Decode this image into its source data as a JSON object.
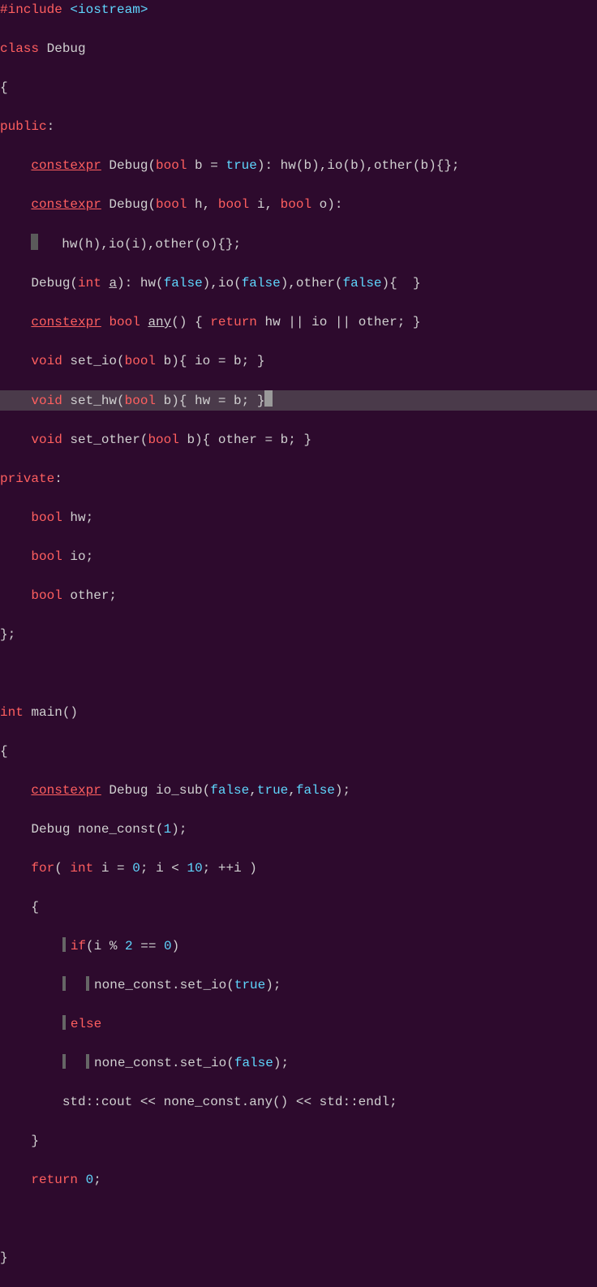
{
  "code": {
    "lines": [
      {
        "hl": false,
        "segs": [
          {
            "t": "#include",
            "c": "pp"
          },
          {
            "t": " ",
            "c": "txt"
          },
          {
            "t": "<iostream>",
            "c": "inc"
          }
        ]
      },
      {
        "hl": false,
        "segs": [
          {
            "t": "class",
            "c": "kw"
          },
          {
            "t": " Debug",
            "c": "txt"
          }
        ]
      },
      {
        "hl": false,
        "segs": [
          {
            "t": "{",
            "c": "txt"
          }
        ]
      },
      {
        "hl": false,
        "segs": [
          {
            "t": "public",
            "c": "access"
          },
          {
            "t": ":",
            "c": "colon"
          }
        ]
      },
      {
        "hl": false,
        "segs": [
          {
            "t": "    ",
            "c": "txt"
          },
          {
            "t": "constexpr",
            "c": "kw under"
          },
          {
            "t": " Debug(",
            "c": "txt"
          },
          {
            "t": "bool",
            "c": "type"
          },
          {
            "t": " b = ",
            "c": "txt"
          },
          {
            "t": "true",
            "c": "boolv"
          },
          {
            "t": "): hw(b),io(b),other(b){};",
            "c": "txt"
          }
        ]
      },
      {
        "hl": false,
        "segs": [
          {
            "t": "    ",
            "c": "txt"
          },
          {
            "t": "constexpr",
            "c": "kw under"
          },
          {
            "t": " Debug(",
            "c": "txt"
          },
          {
            "t": "bool",
            "c": "type"
          },
          {
            "t": " h, ",
            "c": "txt"
          },
          {
            "t": "bool",
            "c": "type"
          },
          {
            "t": " i, ",
            "c": "txt"
          },
          {
            "t": "bool",
            "c": "type"
          },
          {
            "t": " o):",
            "c": "txt"
          }
        ]
      },
      {
        "hl": false,
        "segs": [
          {
            "t": "    ",
            "c": "txt"
          },
          {
            "t": "CURSOR",
            "c": "cursor"
          },
          {
            "t": "   hw(h),io(i),other(o){};",
            "c": "txt"
          }
        ]
      },
      {
        "hl": false,
        "segs": [
          {
            "t": "    Debug(",
            "c": "txt"
          },
          {
            "t": "int",
            "c": "type"
          },
          {
            "t": " ",
            "c": "txt"
          },
          {
            "t": "a",
            "c": "txt under"
          },
          {
            "t": "): hw(",
            "c": "txt"
          },
          {
            "t": "false",
            "c": "boolv"
          },
          {
            "t": "),io(",
            "c": "txt"
          },
          {
            "t": "false",
            "c": "boolv"
          },
          {
            "t": "),other(",
            "c": "txt"
          },
          {
            "t": "false",
            "c": "boolv"
          },
          {
            "t": "){  }",
            "c": "txt"
          }
        ]
      },
      {
        "hl": false,
        "segs": [
          {
            "t": "    ",
            "c": "txt"
          },
          {
            "t": "constexpr",
            "c": "kw under"
          },
          {
            "t": " ",
            "c": "txt"
          },
          {
            "t": "bool",
            "c": "type"
          },
          {
            "t": " ",
            "c": "txt"
          },
          {
            "t": "any",
            "c": "txt under"
          },
          {
            "t": "() { ",
            "c": "txt"
          },
          {
            "t": "return",
            "c": "kw"
          },
          {
            "t": " hw || io || other; }",
            "c": "txt"
          }
        ]
      },
      {
        "hl": false,
        "segs": [
          {
            "t": "    ",
            "c": "txt"
          },
          {
            "t": "void",
            "c": "type"
          },
          {
            "t": " set_io(",
            "c": "txt"
          },
          {
            "t": "bool",
            "c": "type"
          },
          {
            "t": " b){ io = b; }",
            "c": "txt"
          }
        ]
      },
      {
        "hl": true,
        "segs": [
          {
            "t": "    ",
            "c": "txt"
          },
          {
            "t": "void",
            "c": "type"
          },
          {
            "t": " set_hw(",
            "c": "txt"
          },
          {
            "t": "bool",
            "c": "type"
          },
          {
            "t": " b){ hw = b; }",
            "c": "txt"
          },
          {
            "t": "CUR2",
            "c": "cur2"
          }
        ]
      },
      {
        "hl": false,
        "segs": [
          {
            "t": "    ",
            "c": "txt"
          },
          {
            "t": "void",
            "c": "type"
          },
          {
            "t": " set_other(",
            "c": "txt"
          },
          {
            "t": "bool",
            "c": "type"
          },
          {
            "t": " b){ other = b; }",
            "c": "txt"
          }
        ]
      },
      {
        "hl": false,
        "segs": [
          {
            "t": "private",
            "c": "access"
          },
          {
            "t": ":",
            "c": "colon"
          }
        ]
      },
      {
        "hl": false,
        "segs": [
          {
            "t": "    ",
            "c": "txt"
          },
          {
            "t": "bool",
            "c": "type"
          },
          {
            "t": " hw;",
            "c": "txt"
          }
        ]
      },
      {
        "hl": false,
        "segs": [
          {
            "t": "    ",
            "c": "txt"
          },
          {
            "t": "bool",
            "c": "type"
          },
          {
            "t": " io;",
            "c": "txt"
          }
        ]
      },
      {
        "hl": false,
        "segs": [
          {
            "t": "    ",
            "c": "txt"
          },
          {
            "t": "bool",
            "c": "type"
          },
          {
            "t": " other;",
            "c": "txt"
          }
        ]
      },
      {
        "hl": false,
        "segs": [
          {
            "t": "};",
            "c": "txt"
          }
        ]
      },
      {
        "hl": false,
        "segs": [
          {
            "t": " ",
            "c": "txt"
          }
        ]
      },
      {
        "hl": false,
        "segs": [
          {
            "t": "int",
            "c": "type"
          },
          {
            "t": " main()",
            "c": "txt"
          }
        ]
      },
      {
        "hl": false,
        "segs": [
          {
            "t": "{",
            "c": "txt"
          }
        ]
      },
      {
        "hl": false,
        "segs": [
          {
            "t": "    ",
            "c": "txt"
          },
          {
            "t": "constexpr",
            "c": "kw under"
          },
          {
            "t": " Debug io_sub(",
            "c": "txt"
          },
          {
            "t": "false",
            "c": "boolv"
          },
          {
            "t": ",",
            "c": "txt"
          },
          {
            "t": "true",
            "c": "boolv"
          },
          {
            "t": ",",
            "c": "txt"
          },
          {
            "t": "false",
            "c": "boolv"
          },
          {
            "t": ");",
            "c": "txt"
          }
        ]
      },
      {
        "hl": false,
        "segs": [
          {
            "t": "    Debug none_const(",
            "c": "txt"
          },
          {
            "t": "1",
            "c": "num"
          },
          {
            "t": ");",
            "c": "txt"
          }
        ]
      },
      {
        "hl": false,
        "segs": [
          {
            "t": "    ",
            "c": "txt"
          },
          {
            "t": "for",
            "c": "kw"
          },
          {
            "t": "( ",
            "c": "txt"
          },
          {
            "t": "int",
            "c": "type"
          },
          {
            "t": " i = ",
            "c": "txt"
          },
          {
            "t": "0",
            "c": "num"
          },
          {
            "t": "; i < ",
            "c": "txt"
          },
          {
            "t": "10",
            "c": "num"
          },
          {
            "t": "; ++i )",
            "c": "txt"
          }
        ]
      },
      {
        "hl": false,
        "segs": [
          {
            "t": "    {",
            "c": "txt"
          }
        ]
      },
      {
        "hl": false,
        "segs": [
          {
            "t": "        ",
            "c": "txt"
          },
          {
            "t": "GUIDE",
            "c": "indent-guide"
          },
          {
            "t": "if",
            "c": "kw"
          },
          {
            "t": "(i % ",
            "c": "txt"
          },
          {
            "t": "2",
            "c": "num"
          },
          {
            "t": " == ",
            "c": "txt"
          },
          {
            "t": "0",
            "c": "num"
          },
          {
            "t": ")",
            "c": "txt"
          }
        ]
      },
      {
        "hl": false,
        "segs": [
          {
            "t": "        ",
            "c": "txt"
          },
          {
            "t": "GUIDE",
            "c": "indent-guide"
          },
          {
            "t": "  ",
            "c": "txt"
          },
          {
            "t": "GUIDE",
            "c": "indent-guide"
          },
          {
            "t": "none_const.set_io(",
            "c": "txt"
          },
          {
            "t": "true",
            "c": "boolv"
          },
          {
            "t": ");",
            "c": "txt"
          }
        ]
      },
      {
        "hl": false,
        "segs": [
          {
            "t": "        ",
            "c": "txt"
          },
          {
            "t": "GUIDE",
            "c": "indent-guide"
          },
          {
            "t": "else",
            "c": "kw"
          }
        ]
      },
      {
        "hl": false,
        "segs": [
          {
            "t": "        ",
            "c": "txt"
          },
          {
            "t": "GUIDE",
            "c": "indent-guide"
          },
          {
            "t": "  ",
            "c": "txt"
          },
          {
            "t": "GUIDE",
            "c": "indent-guide"
          },
          {
            "t": "none_const.set_io(",
            "c": "txt"
          },
          {
            "t": "false",
            "c": "boolv"
          },
          {
            "t": ");",
            "c": "txt"
          }
        ]
      },
      {
        "hl": false,
        "segs": [
          {
            "t": "        std::cout << none_const.any() << std::endl;",
            "c": "txt"
          }
        ]
      },
      {
        "hl": false,
        "segs": [
          {
            "t": "    }",
            "c": "txt"
          }
        ]
      },
      {
        "hl": false,
        "segs": [
          {
            "t": "    ",
            "c": "txt"
          },
          {
            "t": "return",
            "c": "kw"
          },
          {
            "t": " ",
            "c": "txt"
          },
          {
            "t": "0",
            "c": "num"
          },
          {
            "t": ";",
            "c": "txt"
          }
        ]
      },
      {
        "hl": false,
        "segs": [
          {
            "t": " ",
            "c": "txt"
          }
        ]
      },
      {
        "hl": false,
        "segs": [
          {
            "t": "}",
            "c": "txt"
          }
        ]
      }
    ]
  }
}
